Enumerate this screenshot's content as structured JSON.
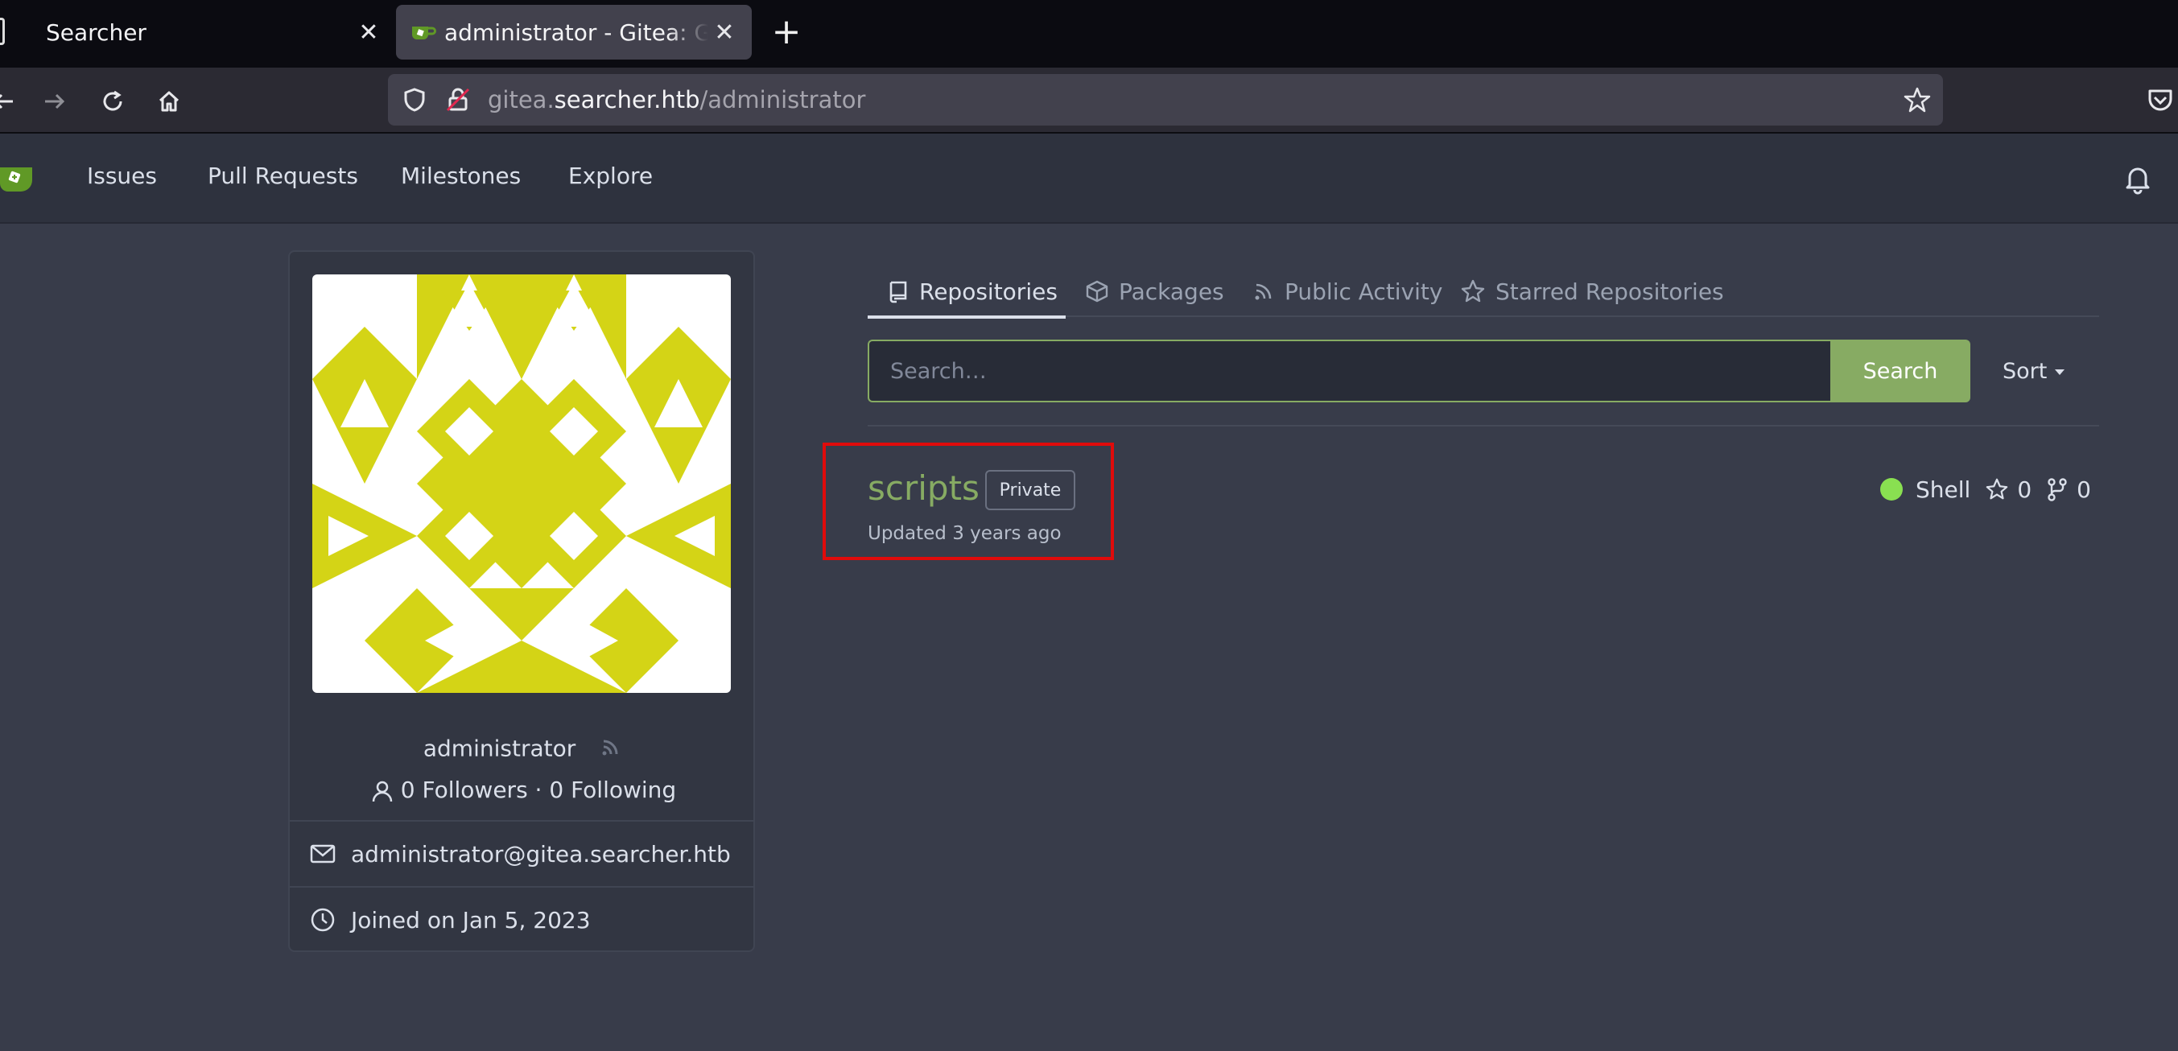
{
  "browser": {
    "tabs": [
      {
        "title": "Searcher",
        "active": false
      },
      {
        "title": "administrator - Gitea: Git with a cup of tea",
        "active": true
      }
    ],
    "url_host_prefix": "gitea.",
    "url_host_main": "searcher.htb",
    "url_path": "/administrator"
  },
  "header": {
    "nav": [
      "Issues",
      "Pull Requests",
      "Milestones",
      "Explore"
    ]
  },
  "profile": {
    "username": "administrator",
    "followers_text": "0 Followers · 0 Following",
    "email": "administrator@gitea.searcher.htb",
    "joined": "Joined on Jan 5, 2023",
    "avatar_color": "#d4d416"
  },
  "tabs": [
    {
      "label": "Repositories",
      "icon": "repo-icon",
      "active": true
    },
    {
      "label": "Packages",
      "icon": "package-icon",
      "active": false
    },
    {
      "label": "Public Activity",
      "icon": "rss-icon",
      "active": false
    },
    {
      "label": "Starred Repositories",
      "icon": "star-icon",
      "active": false
    }
  ],
  "search": {
    "placeholder": "Search…",
    "button_label": "Search",
    "sort_label": "Sort"
  },
  "repos": [
    {
      "name": "scripts",
      "visibility": "Private",
      "updated": "Updated 3 years ago",
      "language": "Shell",
      "language_color": "#89e051",
      "stars": "0",
      "forks": "0"
    }
  ],
  "colors": {
    "accent": "#87ab63",
    "highlight_box": "#e00b0b"
  }
}
